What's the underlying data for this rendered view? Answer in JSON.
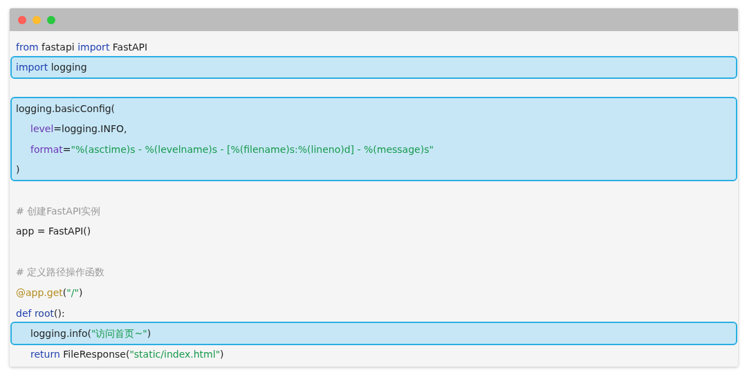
{
  "window": {
    "buttons": [
      {
        "kind": "close"
      },
      {
        "kind": "minimize"
      },
      {
        "kind": "zoom"
      }
    ]
  },
  "blocks": [
    {
      "highlighted": false,
      "lines": [
        {
          "kind": "code",
          "indent": false,
          "tokens": [
            {
              "kind": "keyword",
              "text": "from"
            },
            {
              "kind": "plain",
              "text": " fastapi "
            },
            {
              "kind": "keyword",
              "text": "import"
            },
            {
              "kind": "plain",
              "text": " FastAPI"
            }
          ]
        }
      ]
    },
    {
      "highlighted": true,
      "lines": [
        {
          "kind": "code",
          "indent": false,
          "tokens": [
            {
              "kind": "keyword",
              "text": "import"
            },
            {
              "kind": "plain",
              "text": " logging"
            }
          ]
        }
      ]
    },
    {
      "highlighted": false,
      "lines": [
        {
          "kind": "blank"
        }
      ]
    },
    {
      "highlighted": true,
      "lines": [
        {
          "kind": "code",
          "indent": false,
          "tokens": [
            {
              "kind": "plain",
              "text": "logging.basicConfig("
            }
          ]
        },
        {
          "kind": "code",
          "indent": true,
          "tokens": [
            {
              "kind": "param",
              "text": "level"
            },
            {
              "kind": "plain",
              "text": "=logging.INFO,"
            }
          ]
        },
        {
          "kind": "code",
          "indent": true,
          "tokens": [
            {
              "kind": "param",
              "text": "format"
            },
            {
              "kind": "plain",
              "text": "="
            },
            {
              "kind": "string",
              "text": "\"%(asctime)s - %(levelname)s - [%(filename)s:%(lineno)d] - %(message)s\""
            }
          ]
        },
        {
          "kind": "code",
          "indent": false,
          "tokens": [
            {
              "kind": "plain",
              "text": ")"
            }
          ]
        }
      ]
    },
    {
      "highlighted": false,
      "lines": [
        {
          "kind": "blank"
        },
        {
          "kind": "code",
          "indent": false,
          "tokens": [
            {
              "kind": "comment",
              "text": "# 创建FastAPI实例"
            }
          ]
        },
        {
          "kind": "code",
          "indent": false,
          "tokens": [
            {
              "kind": "plain",
              "text": "app = FastAPI()"
            }
          ]
        },
        {
          "kind": "blank"
        },
        {
          "kind": "code",
          "indent": false,
          "tokens": [
            {
              "kind": "comment",
              "text": "# 定义路径操作函数"
            }
          ]
        },
        {
          "kind": "code",
          "indent": false,
          "tokens": [
            {
              "kind": "decorator",
              "text": "@app.get"
            },
            {
              "kind": "plain",
              "text": "("
            },
            {
              "kind": "string",
              "text": "\"/\""
            },
            {
              "kind": "plain",
              "text": ")"
            }
          ]
        },
        {
          "kind": "code",
          "indent": false,
          "tokens": [
            {
              "kind": "keyword",
              "text": "def"
            },
            {
              "kind": "func",
              "text": " root"
            },
            {
              "kind": "plain",
              "text": "():"
            }
          ]
        }
      ]
    },
    {
      "highlighted": true,
      "lines": [
        {
          "kind": "code",
          "indent": true,
          "tokens": [
            {
              "kind": "plain",
              "text": "logging.info("
            },
            {
              "kind": "string",
              "text": "\"访问首页~\""
            },
            {
              "kind": "plain",
              "text": ")"
            }
          ]
        }
      ]
    },
    {
      "highlighted": false,
      "lines": [
        {
          "kind": "code",
          "indent": true,
          "tokens": [
            {
              "kind": "keyword",
              "text": "return"
            },
            {
              "kind": "plain",
              "text": " FileResponse("
            },
            {
              "kind": "string",
              "text": "\"static/index.html\""
            },
            {
              "kind": "plain",
              "text": ")"
            }
          ]
        }
      ]
    }
  ]
}
